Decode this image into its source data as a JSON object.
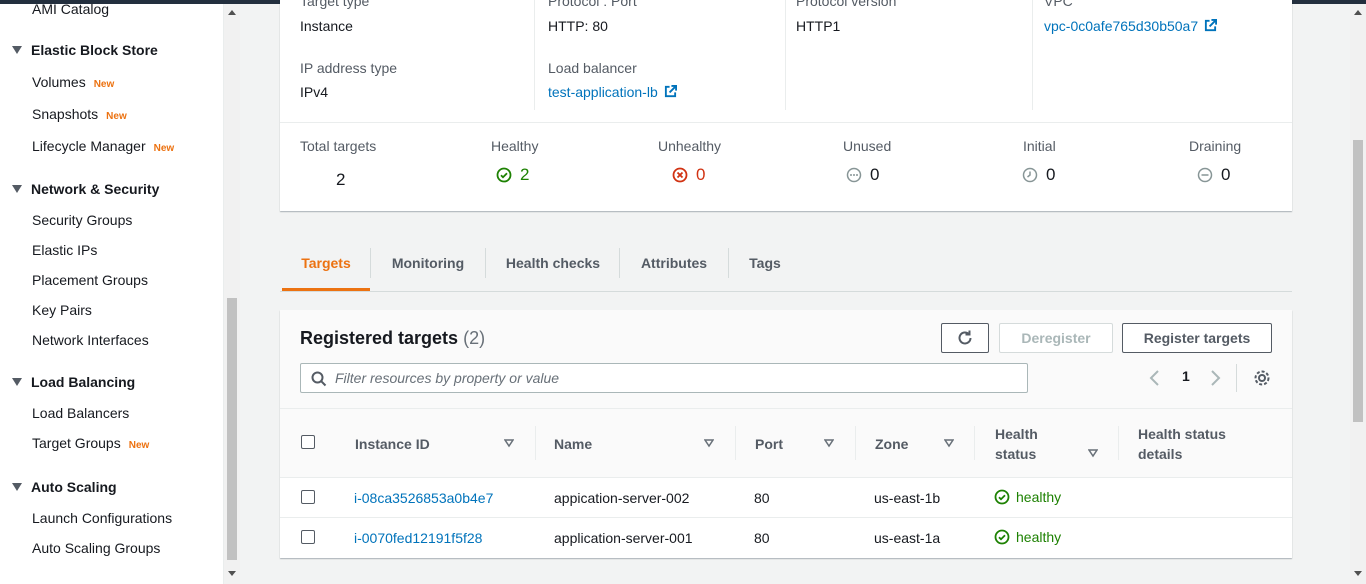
{
  "sidebar": {
    "items": [
      {
        "label": "AMI Catalog",
        "new": ""
      },
      {
        "label": "Volumes",
        "new": "New"
      },
      {
        "label": "Snapshots",
        "new": "New"
      },
      {
        "label": "Lifecycle Manager",
        "new": "New"
      },
      {
        "label": "Security Groups",
        "new": ""
      },
      {
        "label": "Elastic IPs",
        "new": ""
      },
      {
        "label": "Placement Groups",
        "new": ""
      },
      {
        "label": "Key Pairs",
        "new": ""
      },
      {
        "label": "Network Interfaces",
        "new": ""
      },
      {
        "label": "Load Balancers",
        "new": ""
      },
      {
        "label": "Target Groups",
        "new": "New"
      },
      {
        "label": "Launch Configurations",
        "new": ""
      },
      {
        "label": "Auto Scaling Groups",
        "new": ""
      }
    ],
    "sections": [
      "Elastic Block Store",
      "Network & Security",
      "Load Balancing",
      "Auto Scaling"
    ]
  },
  "details": {
    "labels": {
      "target_type": "Target type",
      "protocol_port": "Protocol : Port",
      "protocol_version": "Protocol version",
      "vpc": "VPC",
      "ip_type": "IP address type",
      "load_balancer": "Load balancer"
    },
    "values": {
      "target_type": "Instance",
      "protocol_port": "HTTP: 80",
      "protocol_version": "HTTP1",
      "vpc": "vpc-0c0afe765d30b50a7",
      "ip_type": "IPv4",
      "load_balancer": "test-application-lb"
    },
    "stats": {
      "total_label": "Total targets",
      "total": "2",
      "healthy_label": "Healthy",
      "healthy": "2",
      "unhealthy_label": "Unhealthy",
      "unhealthy": "0",
      "unused_label": "Unused",
      "unused": "0",
      "initial_label": "Initial",
      "initial": "0",
      "draining_label": "Draining",
      "draining": "0"
    }
  },
  "tabs": [
    "Targets",
    "Monitoring",
    "Health checks",
    "Attributes",
    "Tags"
  ],
  "targets": {
    "title": "Registered targets",
    "count": "(2)",
    "deregister_label": "Deregister",
    "register_label": "Register targets",
    "search_placeholder": "Filter resources by property or value",
    "page": "1",
    "columns": {
      "instance_id": "Instance ID",
      "name": "Name",
      "port": "Port",
      "zone": "Zone",
      "health_1": "Health",
      "health_2": "status",
      "details_1": "Health status",
      "details_2": "details"
    },
    "rows": [
      {
        "instance_id": "i-08ca3526853a0b4e7",
        "name": "appication-server-002",
        "port": "80",
        "zone": "us-east-1b",
        "health": "healthy",
        "details": ""
      },
      {
        "instance_id": "i-0070fed12191f5f28",
        "name": "application-server-001",
        "port": "80",
        "zone": "us-east-1a",
        "health": "healthy",
        "details": ""
      }
    ]
  },
  "colors": {
    "accent": "#ec7211",
    "link": "#0073bb",
    "success": "#1d8102",
    "error": "#d13212"
  }
}
